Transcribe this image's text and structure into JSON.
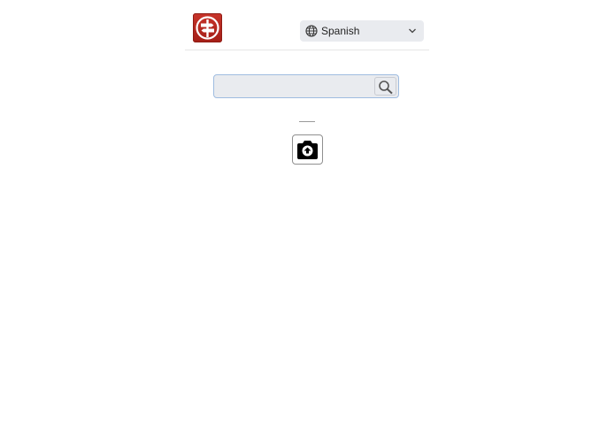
{
  "header": {
    "logo_icon": "signpost-icon",
    "logo_color": "#b4271e",
    "language_select": {
      "selected": "Spanish",
      "icon": "globe-icon",
      "dropdown_icon": "chevron-down-icon"
    }
  },
  "search": {
    "value": "",
    "placeholder": "",
    "button_icon": "search-icon",
    "border_color": "#9fbce0"
  },
  "camera": {
    "icon": "camera-flip-icon"
  }
}
